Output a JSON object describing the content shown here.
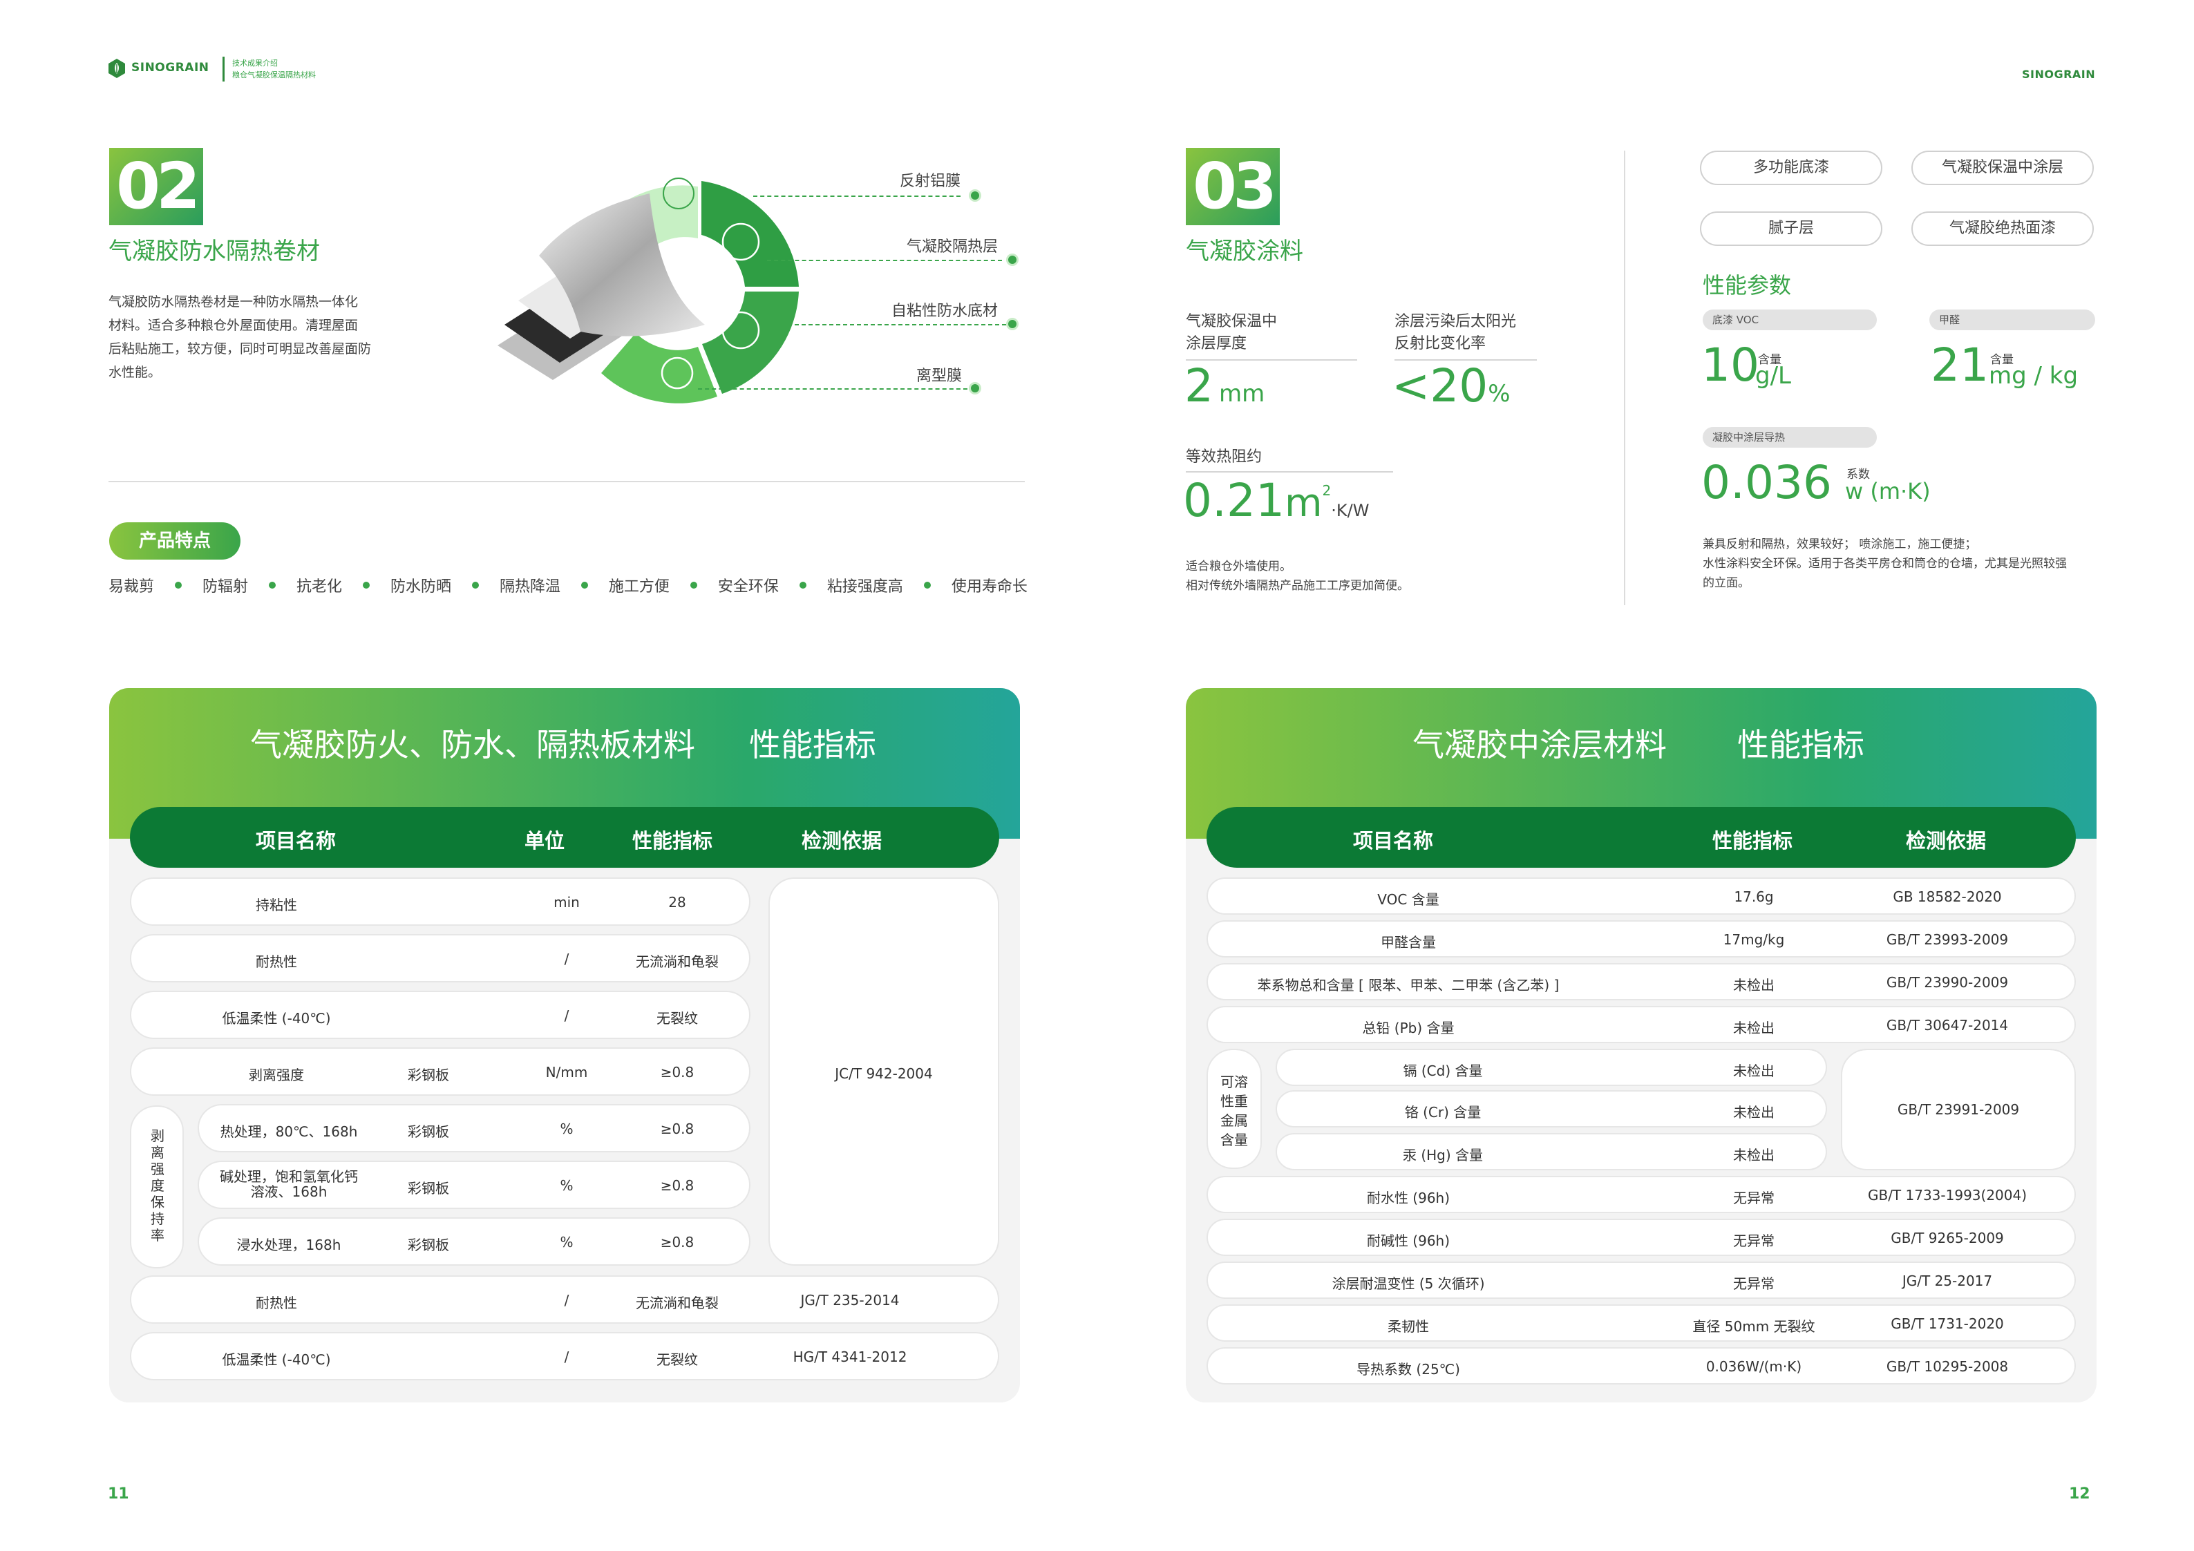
{
  "header": {
    "brand_left": "SINOGRAIN",
    "line1": "技术成果介绍",
    "line2": "粮仓气凝胶保温隔热材料",
    "brand_right": "SINOGRAIN",
    "logo_icon": "grain-logo-icon"
  },
  "sec2": {
    "number": "02",
    "title": "气凝胶防水隔热卷材",
    "desc_lines": [
      "气凝胶防水隔热卷材是一种防水隔热一体化",
      "材料。适合多种粮仓外屋面使用。清理屋面",
      "后粘贴施工，较方便，同时可明显改善屋面防",
      "水性能。"
    ],
    "callouts": [
      "反射铝膜",
      "气凝胶隔热层",
      "自粘性防水底材",
      "离型膜"
    ],
    "features_label": "产品特点",
    "features": [
      "易裁剪",
      "防辐射",
      "抗老化",
      "防水防晒",
      "隔热降温",
      "施工方便",
      "安全环保",
      "粘接强度高",
      "使用寿命长"
    ]
  },
  "sec3": {
    "number": "03",
    "title": "气凝胶涂料",
    "layers": [
      "多功能底漆",
      "气凝胶保温中涂层",
      "腻子层",
      "气凝胶绝热面漆"
    ],
    "stats": [
      {
        "label_lines": [
          "气凝胶保温中",
          "涂层厚度"
        ],
        "value": "2",
        "unit": "mm"
      },
      {
        "label_lines": [
          "涂层污染后太阳光",
          "反射比变化率"
        ],
        "value": "<20",
        "unit": "%"
      },
      {
        "label_lines": [
          "等效热阻约"
        ],
        "value": "0.21",
        "unit": "m",
        "unit_sup": "2",
        "unit_tail": "·K/W"
      }
    ],
    "note_lines": [
      "适合粮仓外墙使用。",
      "相对传统外墙隔热产品施工工序更加简便。"
    ],
    "perf_title": "性能参数",
    "params": [
      {
        "tag": "底漆 VOC",
        "small": "含量",
        "value": "10",
        "unit": "g/L"
      },
      {
        "tag": "甲醛",
        "small": "含量",
        "value": "21",
        "unit": "mg / kg"
      },
      {
        "tag": "凝胶中涂层导热",
        "small": "系数",
        "value": "0.036",
        "unit": "w (m·K)"
      }
    ],
    "perf_note_lines": [
      "兼具反射和隔热，效果较好； 喷涂施工，施工便捷；",
      "水性涂料安全环保。适用于各类平房仓和筒仓的仓墙，尤其是光照较强",
      "的立面。"
    ]
  },
  "table1": {
    "title_a": "气凝胶防火、防水、隔热板材料",
    "title_b": "性能指标",
    "headers": [
      "项目名称",
      "单位",
      "性能指标",
      "检测依据"
    ],
    "rows": [
      {
        "name": "持粘性",
        "sub": "",
        "unit": "min",
        "value": "28"
      },
      {
        "name": "耐热性",
        "sub": "",
        "unit": "/",
        "value": "无流淌和龟裂"
      },
      {
        "name": "低温柔性 (-40℃)",
        "sub": "",
        "unit": "/",
        "value": "无裂纹"
      },
      {
        "name": "剥离强度",
        "sub": "彩钢板",
        "unit": "N/mm",
        "value": "≥0.8"
      }
    ],
    "group_label": "剥离强度保持率",
    "group_rows": [
      {
        "name": "热处理，80℃、168h",
        "sub": "彩钢板",
        "unit": "%",
        "value": "≥0.8"
      },
      {
        "name_lines": [
          "碱处理，饱和氢氧化钙",
          "溶液、168h"
        ],
        "sub": "彩钢板",
        "unit": "%",
        "value": "≥0.8"
      },
      {
        "name": "浸水处理，168h",
        "sub": "彩钢板",
        "unit": "%",
        "value": "≥0.8"
      }
    ],
    "merged_basis": "JC/T 942-2004",
    "tail_rows": [
      {
        "name": "耐热性",
        "unit": "/",
        "value": "无流淌和龟裂",
        "basis": "JG/T 235-2014"
      },
      {
        "name": "低温柔性 (-40℃)",
        "unit": "/",
        "value": "无裂纹",
        "basis": "HG/T 4341-2012"
      }
    ]
  },
  "table2": {
    "title_a": "气凝胶中涂层材料",
    "title_b": "性能指标",
    "headers": [
      "项目名称",
      "性能指标",
      "检测依据"
    ],
    "rows_top": [
      {
        "name": "VOC 含量",
        "value": "17.6g",
        "basis": "GB 18582-2020"
      },
      {
        "name": "甲醛含量",
        "value": "17mg/kg",
        "basis": "GB/T 23993-2009"
      },
      {
        "name": "苯系物总和含量 [ 限苯、甲苯、二甲苯 (含乙苯) ]",
        "value": "未检出",
        "basis": "GB/T 23990-2009"
      },
      {
        "name": "总铅 (Pb) 含量",
        "value": "未检出",
        "basis": "GB/T 30647-2014"
      }
    ],
    "group_label_lines": [
      "可溶",
      "性重",
      "金属",
      "含量"
    ],
    "group_rows": [
      {
        "name": "镉 (Cd) 含量",
        "value": "未检出"
      },
      {
        "name": "铬 (Cr) 含量",
        "value": "未检出"
      },
      {
        "name": "汞 (Hg) 含量",
        "value": "未检出"
      }
    ],
    "group_basis": "GB/T 23991-2009",
    "rows_bottom": [
      {
        "name": "耐水性 (96h)",
        "value": "无异常",
        "basis": "GB/T 1733-1993(2004)"
      },
      {
        "name": "耐碱性 (96h)",
        "value": "无异常",
        "basis": "GB/T 9265-2009"
      },
      {
        "name": "涂层耐温变性 (5 次循环)",
        "value": "无异常",
        "basis": "JG/T 25-2017"
      },
      {
        "name": "柔韧性",
        "value": "直径 50mm 无裂纹",
        "basis": "GB/T 1731-2020"
      },
      {
        "name": "导热系数 (25℃)",
        "value": "0.036W/(m·K)",
        "basis": "GB/T 10295-2008"
      }
    ]
  },
  "page_left": "11",
  "page_right": "12",
  "colors": {
    "accent": "#3aa54a",
    "dark_green": "#0c7a35",
    "lime": "#8ac43f",
    "teal": "#24a59a"
  }
}
